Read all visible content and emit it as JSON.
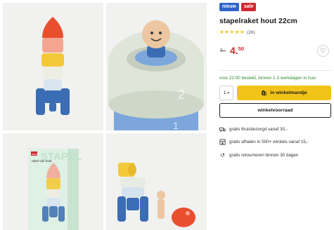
{
  "badges": {
    "new": "nieuw",
    "sale": "sale"
  },
  "product": {
    "title": "stapelraket hout 22cm",
    "rating_stars": "★★★★★",
    "review_count": "(26)",
    "old_price": "9.-",
    "price_int": "4.",
    "price_dec": "50"
  },
  "delivery": {
    "text": "voor 22:00 besteld, binnen 1-3 werkdagen in huis"
  },
  "purchase": {
    "quantity": "1",
    "add_to_cart": "in winkelmandje",
    "store_stock": "winkelvoorraad"
  },
  "usps": [
    {
      "icon": "truck-icon",
      "text": "gratis thuisbezorgd vanaf 30,-"
    },
    {
      "icon": "store-icon",
      "text": "gratis afhalen in 500+ winkels vanaf 15,-"
    },
    {
      "icon": "return-icon",
      "text": "gratis retourneren binnen 30 dagen"
    }
  ],
  "images": {
    "photo2_digit_a": "2",
    "photo2_digit_b": "1",
    "box_brand": "HEMA",
    "box_title": "raket van hout",
    "box_wordmark": "STAPEL"
  },
  "colors": {
    "accent_yellow": "#f2c318",
    "sale_red": "#d2282e",
    "new_blue": "#2f63c9",
    "delivery_green": "#2f8a2c"
  }
}
